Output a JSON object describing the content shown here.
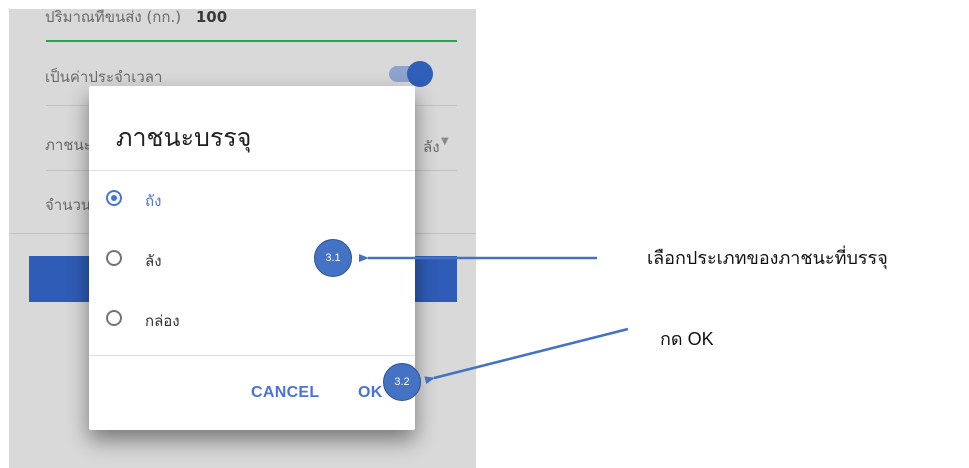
{
  "background_form": {
    "row1_label": "ปริมาณที่ขนส่ง (กก.)",
    "row1_value": "100",
    "row2_label": "เป็นค่าประจำเวลา",
    "row3_label": "ภาชนะบรรจุ",
    "row3_value_suffix": "ลัง",
    "row4_label": "จำนวน"
  },
  "dialog": {
    "title": "ภาชนะบรรจุ",
    "options": [
      {
        "label": "ถัง",
        "checked": true
      },
      {
        "label": "ลัง",
        "checked": false
      },
      {
        "label": "กล่อง",
        "checked": false
      }
    ],
    "cancel_label": "CANCEL",
    "ok_label": "OK"
  },
  "steps": {
    "step1_number": "3.1",
    "step1_text": "เลือกประเภทของภาชนะที่บรรจุ",
    "step2_number": "3.2",
    "step2_text": "กด OK"
  },
  "colors": {
    "accent": "#4a74d4",
    "marker": "#4472c4",
    "toggle": "#2f5fb8",
    "primary_button": "#2f5cb7",
    "underline": "#2e9e4f"
  }
}
